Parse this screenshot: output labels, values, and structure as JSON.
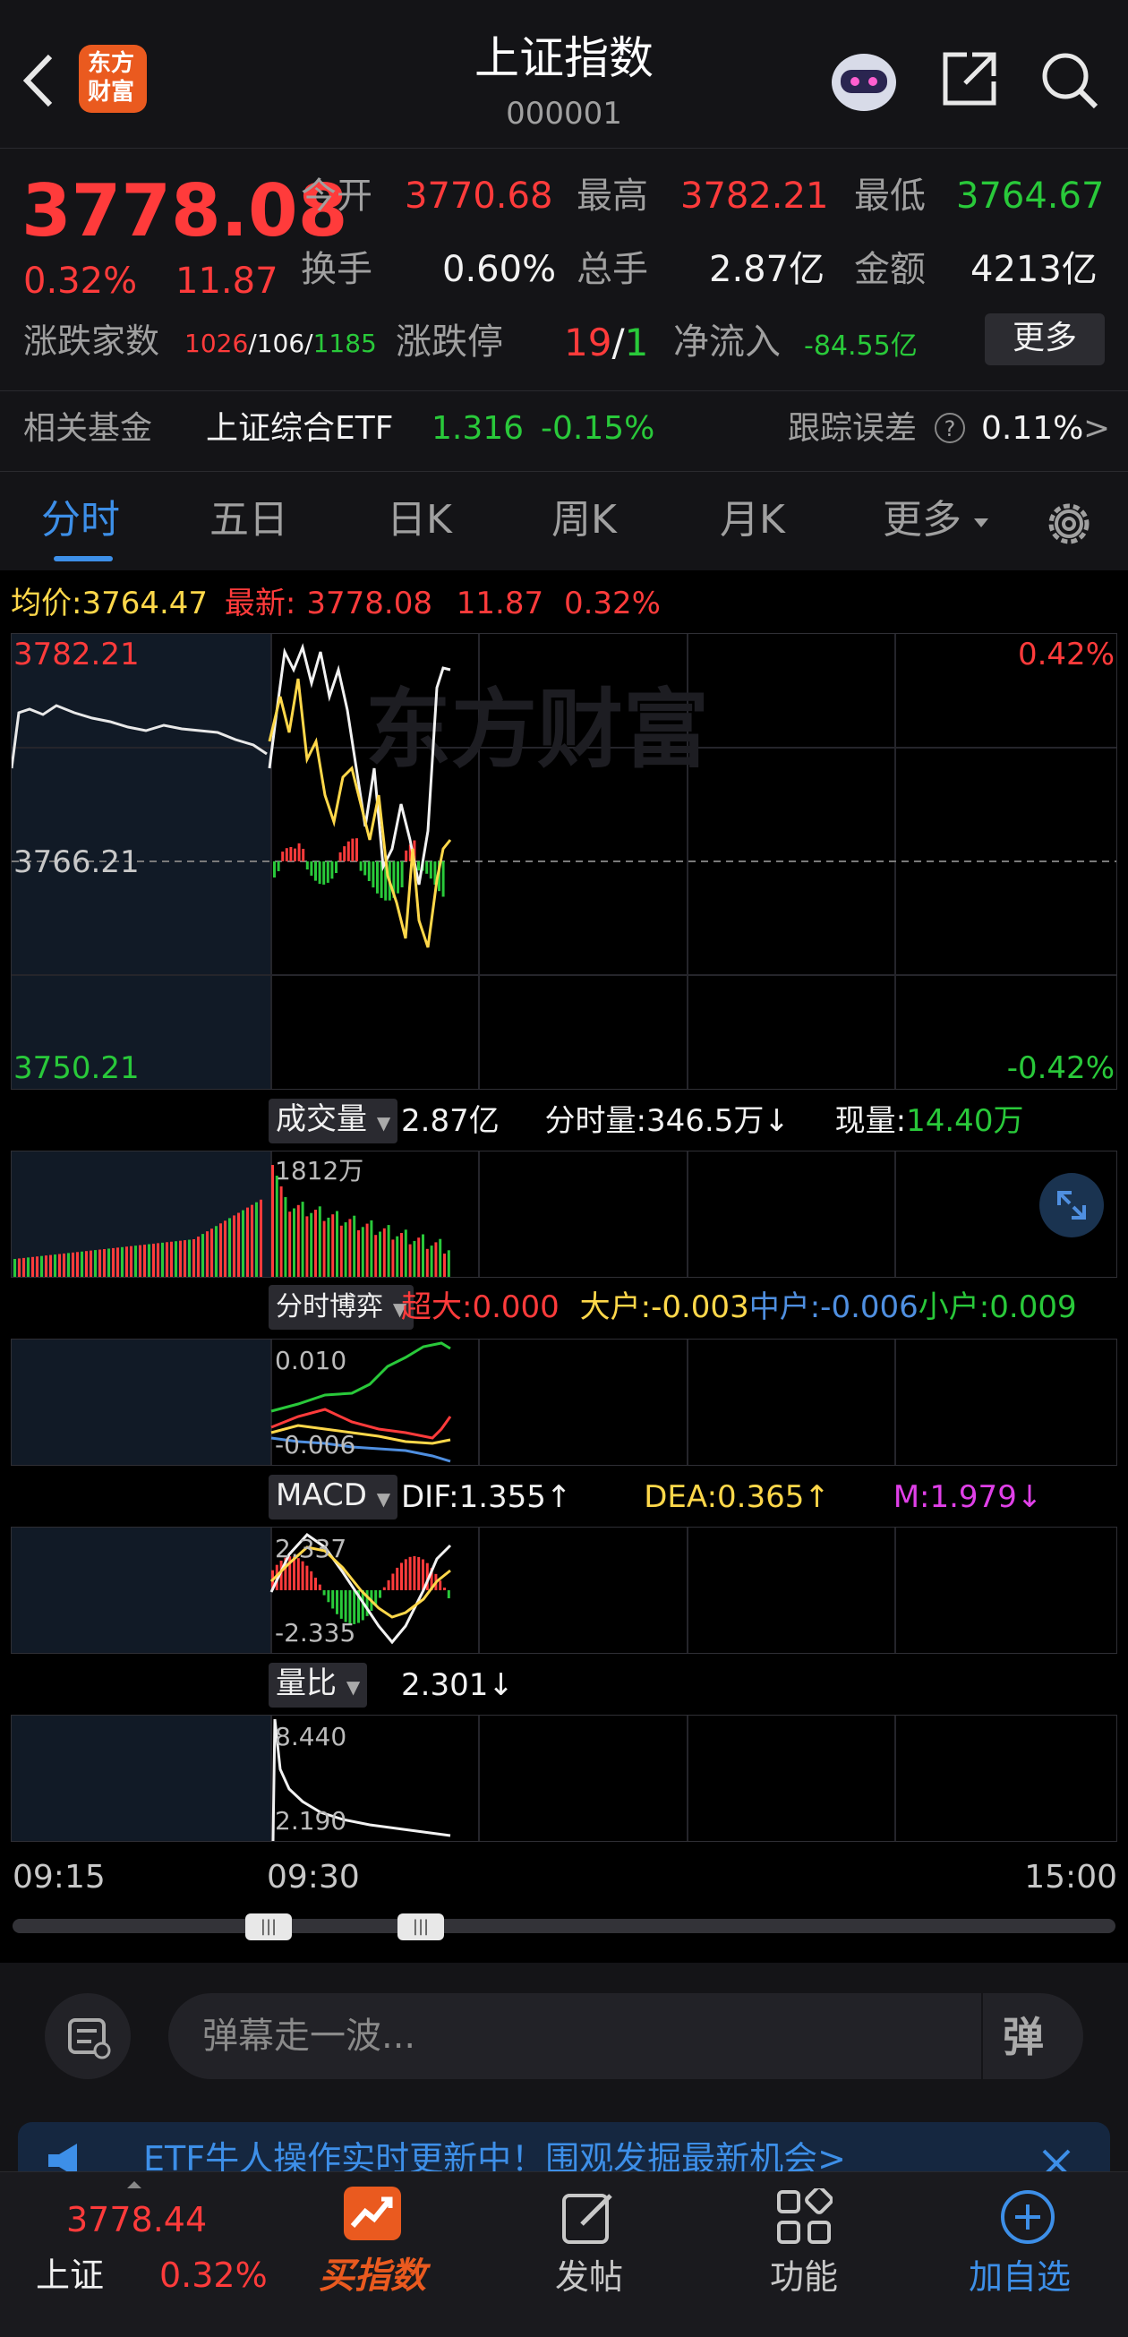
{
  "header": {
    "title": "上证指数",
    "code": "000001",
    "logo_text_line1": "东方",
    "logo_text_line2": "财富"
  },
  "quote": {
    "price": "3778.08",
    "pct": "0.32%",
    "change": "11.87",
    "open_label": "今开",
    "open": "3770.68",
    "high_label": "最高",
    "high": "3782.21",
    "low_label": "最低",
    "low": "3764.67",
    "turnover_label": "换手",
    "turnover": "0.60%",
    "volume_label": "总手",
    "volume": "2.87亿",
    "amount_label": "金额",
    "amount": "4213亿",
    "breadth_label": "涨跌家数",
    "up": "1026",
    "flat": "106",
    "down": "1185",
    "sep": "/",
    "limit_label": "涨跌停",
    "limit_up": "19",
    "limit_down": "1",
    "inflow_label": "净流入",
    "inflow": "-84.55亿",
    "more_button": "更多"
  },
  "fund": {
    "label": "相关基金",
    "name": "上证综合ETF",
    "price": "1.316",
    "pct": "-0.15%",
    "track_label": "跟踪误差",
    "track_value": "0.11%",
    "help": "?",
    "arrow": ">"
  },
  "tabs": [
    "分时",
    "五日",
    "日K",
    "周K",
    "月K",
    "更多"
  ],
  "chart": {
    "avg_label": "均价:",
    "avg": "3764.47",
    "latest_label": "最新:",
    "latest": "3778.08",
    "latest_change": "11.87",
    "latest_pct": "0.32%",
    "y_top": "3782.21",
    "y_mid": "3766.21",
    "y_bot": "3750.21",
    "pct_top": "0.42%",
    "pct_bot": "-0.42%",
    "watermark": "东方财富"
  },
  "volume": {
    "label": "成交量",
    "total": "2.87亿",
    "seg_label": "分时量:",
    "seg": "346.5万",
    "seg_arrow": "↓",
    "now_label": "现量:",
    "now": "14.40万",
    "max": "1812万"
  },
  "game": {
    "label": "分时博弈",
    "xl_label": "超大:",
    "xl": "0.000",
    "l_label": "大户:",
    "l": "-0.003",
    "m_label": "中户:",
    "m": "-0.006",
    "s_label": "小户:",
    "s": "0.009",
    "top": "0.010",
    "bot": "-0.006"
  },
  "macd": {
    "label": "MACD",
    "dif_label": "DIF:",
    "dif": "1.355",
    "dif_arrow": "↑",
    "dea_label": "DEA:",
    "dea": "0.365",
    "dea_arrow": "↑",
    "m_label": "M:",
    "m": "1.979",
    "m_arrow": "↓",
    "top": "2.337",
    "bot": "-2.335"
  },
  "ratio": {
    "label": "量比",
    "value": "2.301",
    "arrow": "↓",
    "top": "8.440",
    "bot": "2.190"
  },
  "time_axis": {
    "start": "09:15",
    "mid": "09:30",
    "end": "15:00"
  },
  "danmaku": {
    "placeholder": "弹幕走一波...",
    "toggle": "弹"
  },
  "banner": {
    "text": "ETF牛人操作实时更新中！围观发掘最新机会>"
  },
  "tabbar": {
    "index_price": "3778.44",
    "index_name": "上证",
    "index_pct": "0.32%",
    "buy": "买指数",
    "post": "发帖",
    "func": "功能",
    "add": "加自选"
  },
  "colors": {
    "up": "#ff3b3b",
    "down": "#29c93a",
    "avg": "#ffd84a",
    "accent": "#3d8fe8"
  }
}
